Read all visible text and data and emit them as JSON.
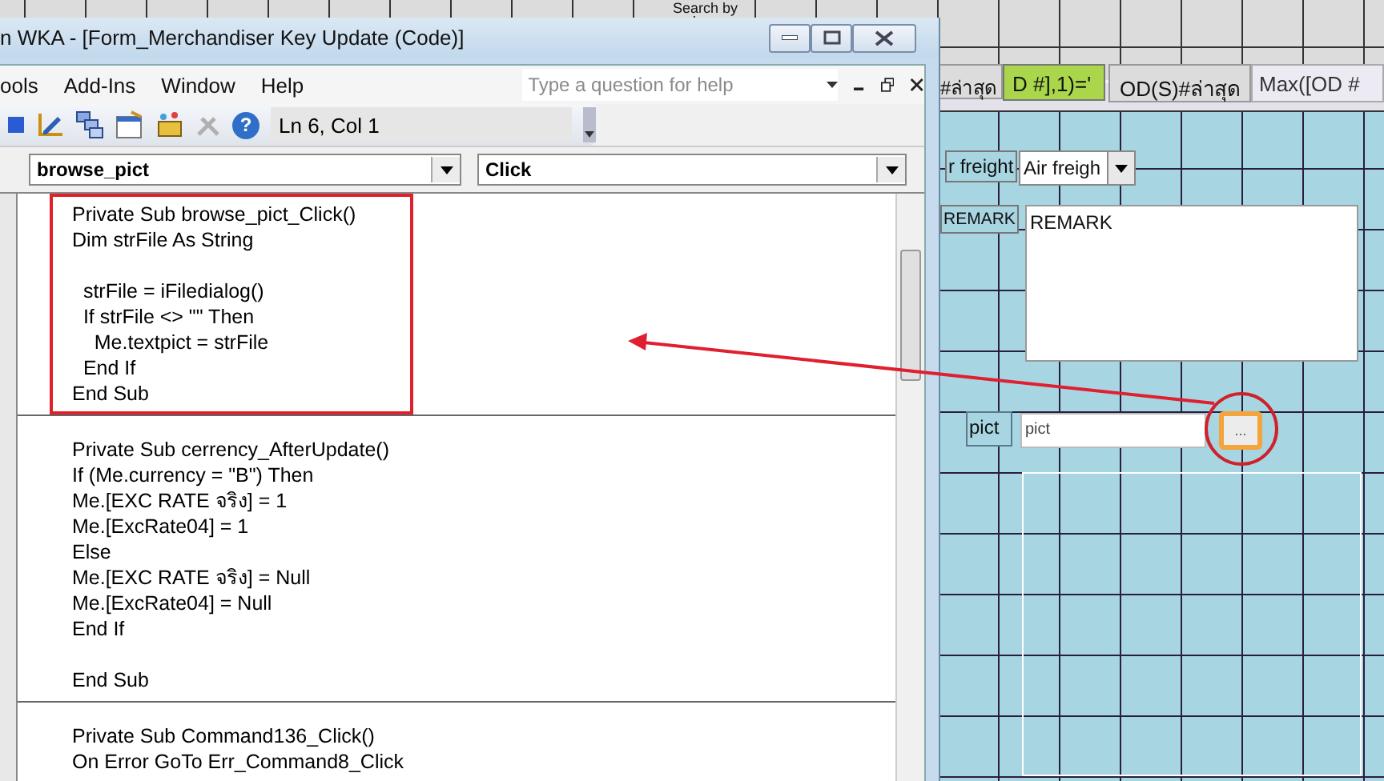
{
  "form_header": {
    "search_by": "Search by",
    "last_label": "#ล่าสุด",
    "formula_box": "D #],1)='",
    "od_label": "OD(S)#ล่าสุด",
    "max_box": "Max([OD #"
  },
  "form_detail": {
    "freight_label": "r freight",
    "freight_combo": "Air freigh",
    "remark_label": "REMARK",
    "remark_box": "REMARK",
    "pict_label": "pict",
    "pict_box": "pict",
    "browse_button": "..."
  },
  "vba_window": {
    "title": "n WKA - [Form_Merchandiser Key Update (Code)]",
    "menu": [
      "ools",
      "Add-Ins",
      "Window",
      "Help"
    ],
    "help_search": {
      "placeholder": "Type a question for help"
    },
    "toolbar": {
      "help_label": "?",
      "position": "Ln 6, Col 1"
    },
    "object_combo": "browse_pict",
    "procedure_combo": "Click",
    "procedures": [
      {
        "highlighted": true,
        "paragraphs": [
          [
            "Private Sub browse_pict_Click()",
            "Dim strFile As String"
          ],
          [
            "  strFile = iFiledialog()",
            "  If strFile <> \"\" Then",
            "    Me.textpict = strFile",
            "  End If",
            "End Sub"
          ]
        ]
      },
      {
        "highlighted": false,
        "paragraphs": [
          [
            "Private Sub cerrency_AfterUpdate()",
            "If (Me.currency = \"B\") Then",
            "Me.[EXC RATE จริง] = 1",
            "Me.[ExcRate04] = 1",
            "Else",
            "Me.[EXC RATE จริง] = Null",
            "Me.[ExcRate04] = Null",
            "End If"
          ],
          [
            "End Sub"
          ]
        ]
      },
      {
        "highlighted": false,
        "paragraphs": [
          [
            "Private Sub Command136_Click()",
            "On Error GoTo Err_Command8_Click"
          ]
        ]
      }
    ]
  }
}
